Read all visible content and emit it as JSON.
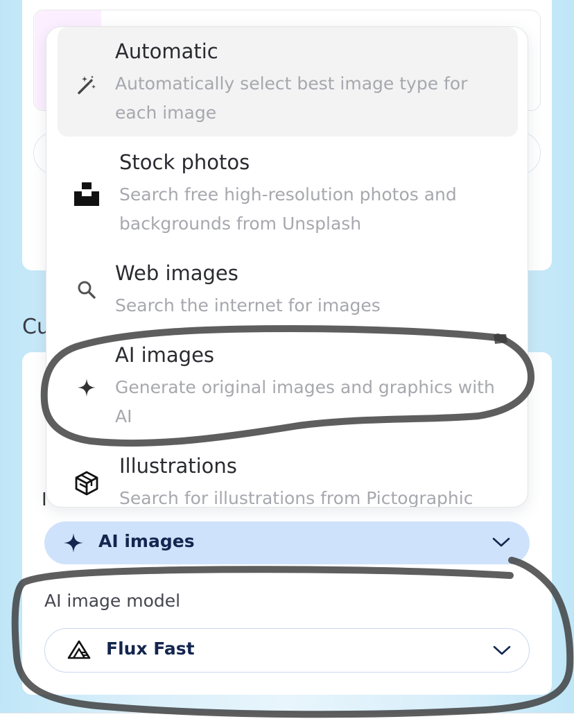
{
  "background_section": {
    "label": "Cu"
  },
  "menu": {
    "items": [
      {
        "icon": "magic-wand-icon",
        "title": "Automatic",
        "description": "Automatically select best image type for each image",
        "active": true
      },
      {
        "icon": "unsplash-logo-icon",
        "title": "Stock photos",
        "description": "Search free high-resolution photos and backgrounds from Unsplash"
      },
      {
        "icon": "search-icon",
        "title": "Web images",
        "description": "Search the internet for images"
      },
      {
        "icon": "sparkle-icon",
        "title": "AI images",
        "description": "Generate original images and graphics with AI"
      },
      {
        "icon": "cube-icon",
        "title": "Illustrations",
        "description": "Search for illustrations from Pictographic"
      }
    ]
  },
  "image_source": {
    "selected_label": "AI images",
    "icon": "sparkle-icon"
  },
  "model": {
    "label": "AI image model",
    "selected_label": "Flux Fast",
    "icon": "flux-logo-icon"
  },
  "colors": {
    "accent": "#cfe2fb",
    "text_primary": "#14264f",
    "annotation": "#3c3c3c"
  }
}
